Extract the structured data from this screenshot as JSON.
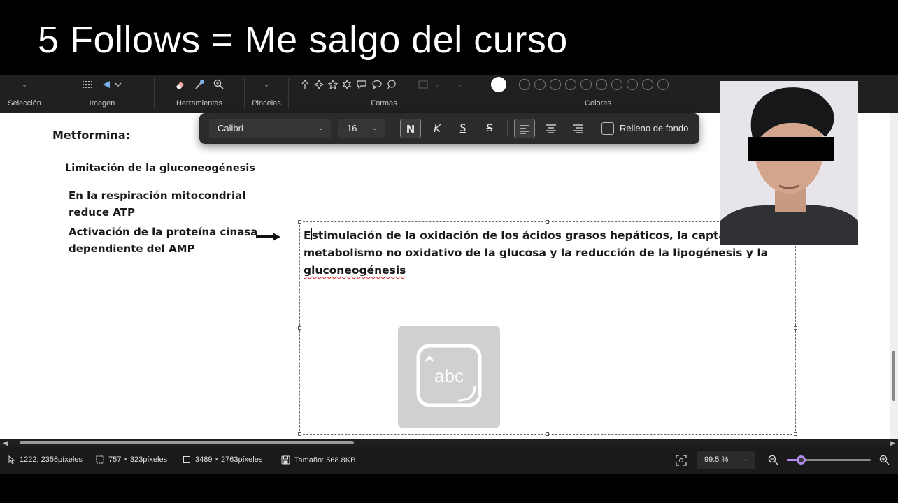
{
  "overlay": {
    "title": "5 Follows = Me salgo del curso"
  },
  "ribbon": {
    "groups": [
      {
        "label": "Selección"
      },
      {
        "label": "Imagen"
      },
      {
        "label": "Herramientas"
      },
      {
        "label": "Pinceles"
      },
      {
        "label": "Formas"
      },
      {
        "label": "Colores"
      }
    ],
    "accent_color": "#b38cf0"
  },
  "format_bar": {
    "font_family": "Calibri",
    "font_size": "16",
    "bold_label": "N",
    "italic_label": "K",
    "underline_label": "S",
    "strike_label": "S",
    "fill_label": "Relleno de fondo",
    "fill_checked": false
  },
  "document": {
    "heading": "Metformina:",
    "subheading": "Limitación de la gluconeogénesis",
    "point1": "En la respiración mitocondrial reduce ATP",
    "point2": "Activación de la proteína cinasa dependiente del AMP",
    "textbox_main": "stimulación de la oxidación de los ácidos grasos hepáticos, la captación y el metabolismo no oxidativo de la glucosa y la reducción de la lipogénesis y la ",
    "textbox_first": "E",
    "textbox_last": "gluconeogénesis",
    "abc_label": "abc"
  },
  "statusbar": {
    "cursor_pos": "1222, 2356píxeles",
    "selection_size": "757 × 323píxeles",
    "canvas_size": "3489 × 2763píxeles",
    "file_size": "Tamaño: 568.8KB",
    "zoom": "99.5 %",
    "zoom_fraction": 0.17
  }
}
